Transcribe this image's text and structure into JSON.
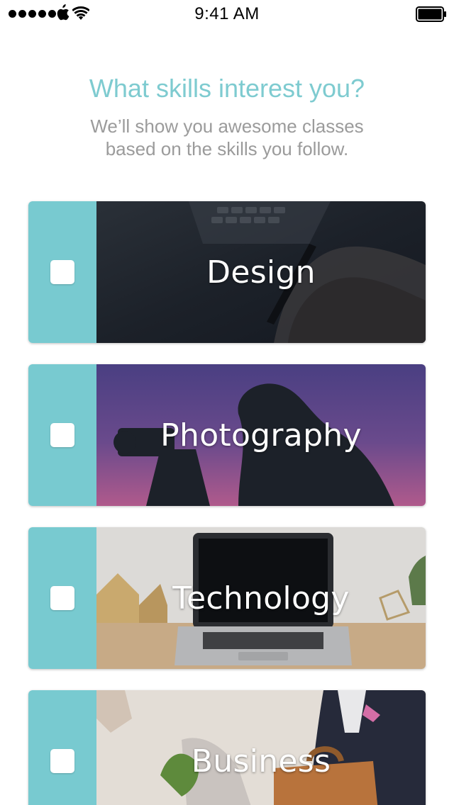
{
  "status_bar": {
    "time": "9:41 AM",
    "icons": [
      "signal-dots-icon",
      "apple-icon",
      "wifi-icon",
      "battery-icon"
    ]
  },
  "header": {
    "title": "What skills interest you?",
    "subtitle": "We’ll show you awesome classes based on the skills you follow."
  },
  "skills": [
    {
      "label": "Design",
      "checked": false
    },
    {
      "label": "Photography",
      "checked": false
    },
    {
      "label": "Technology",
      "checked": false
    },
    {
      "label": "Business",
      "checked": false
    }
  ],
  "colors": {
    "accent": "#78cad0",
    "title": "#7ecbd0",
    "subtitle": "#9b9b9b"
  }
}
